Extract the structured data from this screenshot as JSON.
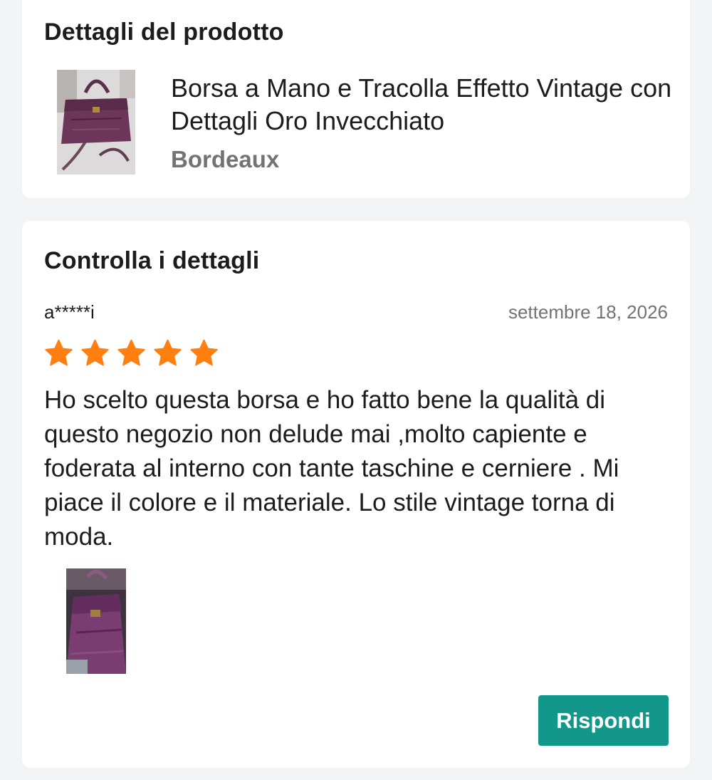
{
  "product_section": {
    "title": "Dettagli del prodotto",
    "product_name": "Borsa a Mano e Tracolla Effetto Vintage con Dettagli Oro Invecchiato",
    "variant": "Bordeaux"
  },
  "review_section": {
    "title": "Controlla i dettagli",
    "username": "a*****i",
    "date": "settembre 18, 2026",
    "rating": 5,
    "rating_max": 5,
    "star_color": "#ff7f11",
    "text": "Ho scelto questa borsa e ho fatto bene la qualità di questo negozio non delude mai ,molto capiente e foderata al interno con tante taschine e cerniere . Mi piace il colore e il materiale. Lo stile vintage torna di moda.",
    "reply_label": "Rispondi"
  },
  "colors": {
    "accent": "#13978a",
    "background": "#f3f4f6",
    "muted_text": "#737373"
  },
  "icons": [
    "star-icon"
  ]
}
